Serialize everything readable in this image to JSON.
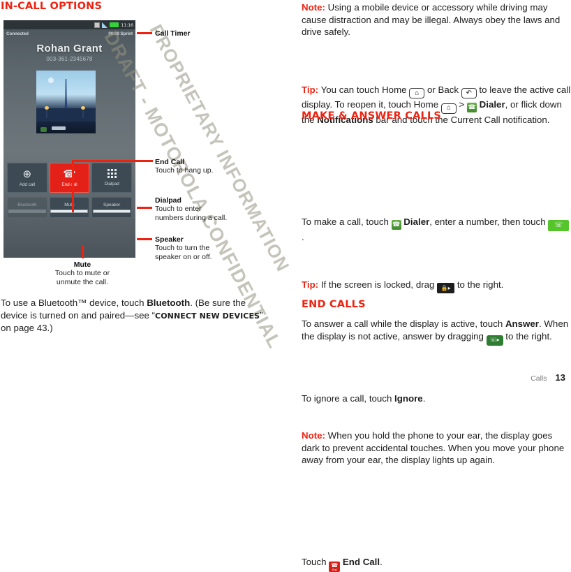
{
  "left": {
    "section_title": "IN-CALL OPTIONS",
    "phone": {
      "status": {
        "time": "11:16",
        "sync_icon": "sync-icon",
        "signal_icon": "signal-bars-icon",
        "battery_icon": "battery-icon"
      },
      "call_state": "Connected",
      "call_timer_carrier": "00:08 Sprint",
      "caller_name": "Rohan Grant",
      "caller_number": "003-361-2345678",
      "photo_alt": "contact-photo-eiffel-tower",
      "buttons": [
        {
          "label": "Add call",
          "icon": "add-call-icon"
        },
        {
          "label": "End call",
          "icon": "end-call-handset-icon"
        },
        {
          "label": "Dialpad",
          "icon": "dialpad-grid-icon"
        }
      ],
      "toggles": [
        {
          "label": "Bluetooth",
          "state": "disabled"
        },
        {
          "label": "Mute",
          "state": "off"
        },
        {
          "label": "Speaker",
          "state": "off"
        }
      ]
    },
    "callouts": [
      {
        "title": "Call Timer",
        "body": ""
      },
      {
        "title": "End Call",
        "body": "Touch to hang up."
      },
      {
        "title": "Dialpad",
        "body": "Touch to enter\nnumbers during a call."
      },
      {
        "title": "Speaker",
        "body": "Touch to turn the\nspeaker on or off."
      },
      {
        "title": "Mute",
        "body": "Touch to mute or\nunmute the call."
      }
    ],
    "bluetooth_paragraph": {
      "t1": "To use a Bluetooth™ device, touch ",
      "b1": "Bluetooth",
      "t2": ". (Be sure the device is turned on and paired—see “",
      "sc1": "CONNECT NEW DEVICES",
      "t3": "” on page 43.)"
    }
  },
  "right": {
    "note1": {
      "lead": "Note:",
      "text": " Using a mobile device or accessory while driving may cause distraction and may be illegal. Always obey the laws and drive safely."
    },
    "tip1": {
      "lead": "Tip:",
      "t1": " You can touch Home ",
      "icon_home": "home-icon",
      "t2": " or Back ",
      "icon_back": "back-icon",
      "t3": " to leave the active call display. To reopen it, touch Home ",
      "icon_home2": "home-icon",
      "t4": " > ",
      "icon_dialer": "dialer-icon",
      "b1": " Dialer",
      "t5": ", or flick down the ",
      "b2": "Notifications",
      "t6": " bar and touch the Current Call notification."
    },
    "section2_title": "MAKE & ANSWER CALLS",
    "make": {
      "t1": "To make a call, touch ",
      "icon_dialer": "dialer-icon",
      "b1": " Dialer",
      "t2": ", enter a number, then touch ",
      "icon_call": "green-call-button-icon",
      "t3": "."
    },
    "tip2": {
      "lead": "Tip:",
      "t1": " If the screen is locked, drag ",
      "icon_lock": "lock-drag-icon",
      "t2": " to the right."
    },
    "answer": {
      "t1": "To answer a call while the display is active, touch ",
      "b1": "Answer",
      "t2": ". When the display is not active, answer by dragging ",
      "icon_answer": "answer-drag-icon",
      "t3": " to the right."
    },
    "ignore": {
      "t1": "To ignore a call, touch ",
      "b1": "Ignore",
      "t2": "."
    },
    "note2": {
      "lead": "Note:",
      "text": " When you hold the phone to your ear, the display goes dark to prevent accidental touches. When you move your phone away from your ear, the display lights up again."
    },
    "section3_title": "END CALLS",
    "end": {
      "t1": "Touch ",
      "icon_end": "end-call-icon",
      "b1": " End Call",
      "t2": "."
    }
  },
  "watermark": {
    "line1": "DRAFT - MOTOROLA CONFIDENTIAL",
    "line2": "PROPRIETARY INFORMATION"
  },
  "footer": {
    "section": "Calls",
    "page": "13"
  },
  "colors": {
    "accent_red": "#ee2211",
    "end_call_red": "#e32119",
    "answer_green": "#55c52b"
  }
}
